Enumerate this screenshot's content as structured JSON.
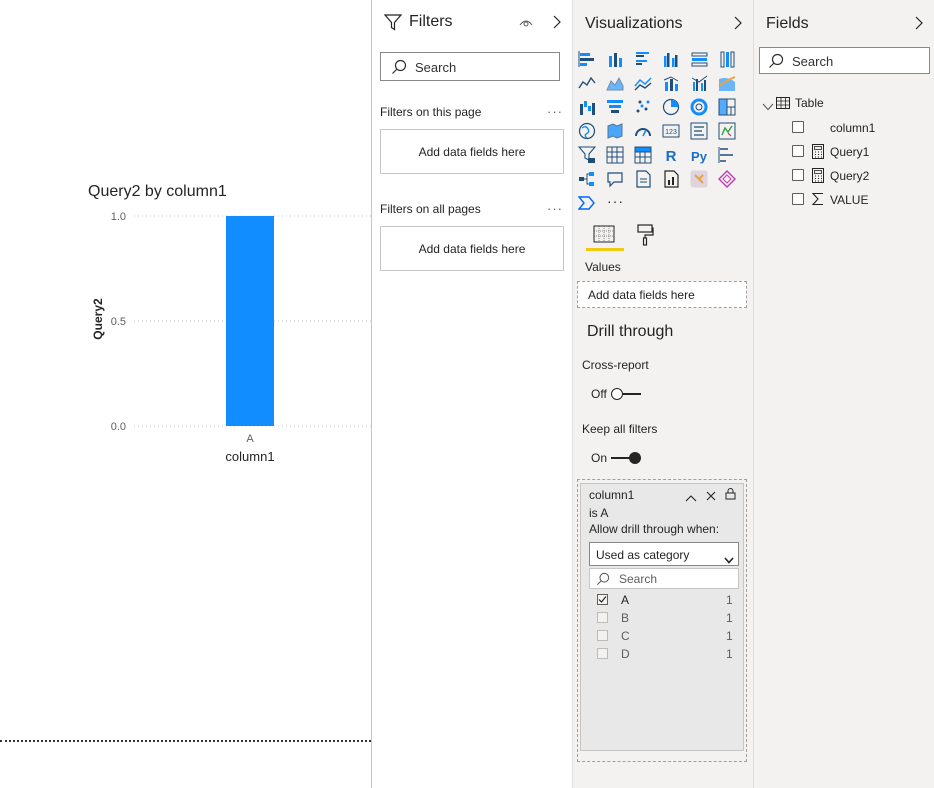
{
  "canvas": {
    "chart_data": {
      "type": "bar",
      "title": "Query2 by column1",
      "xlabel": "column1",
      "ylabel": "Query2",
      "categories": [
        "A"
      ],
      "values": [
        1.0
      ],
      "ylim": [
        0,
        1
      ],
      "yticks": [
        "1.0",
        "0.5",
        "0.0"
      ],
      "grid": true,
      "bar_color": "#118dff"
    }
  },
  "filters": {
    "title": "Filters",
    "search_placeholder": "Search",
    "this_page_label": "Filters on this page",
    "this_page_more": "···",
    "this_page_drop": "Add data fields here",
    "all_pages_label": "Filters on all pages",
    "all_pages_more": "···",
    "all_pages_drop": "Add data fields here"
  },
  "visualizations": {
    "title": "Visualizations",
    "more": "···",
    "values_label": "Values",
    "values_drop": "Add data fields here",
    "drill_title": "Drill through",
    "cross_report_label": "Cross-report",
    "cross_report_state": "Off",
    "keep_filters_label": "Keep all filters",
    "keep_filters_state": "On",
    "accent_color": "#f2c811",
    "icon_color": "#1f4e79",
    "drill_card": {
      "field": "column1",
      "condition": "is A",
      "allow_label": "Allow drill through when:",
      "dropdown_value": "Used as category",
      "search_placeholder": "Search",
      "items": [
        {
          "label": "A",
          "count": "1",
          "checked": true
        },
        {
          "label": "B",
          "count": "1",
          "checked": false
        },
        {
          "label": "C",
          "count": "1",
          "checked": false
        },
        {
          "label": "D",
          "count": "1",
          "checked": false
        }
      ]
    }
  },
  "fields": {
    "title": "Fields",
    "search_placeholder": "Search",
    "table_name": "Table",
    "items": [
      {
        "label": "column1",
        "icon": "none"
      },
      {
        "label": "Query1",
        "icon": "calculator-icon"
      },
      {
        "label": "Query2",
        "icon": "calculator-icon"
      },
      {
        "label": "VALUE",
        "icon": "sigma-icon"
      }
    ]
  }
}
